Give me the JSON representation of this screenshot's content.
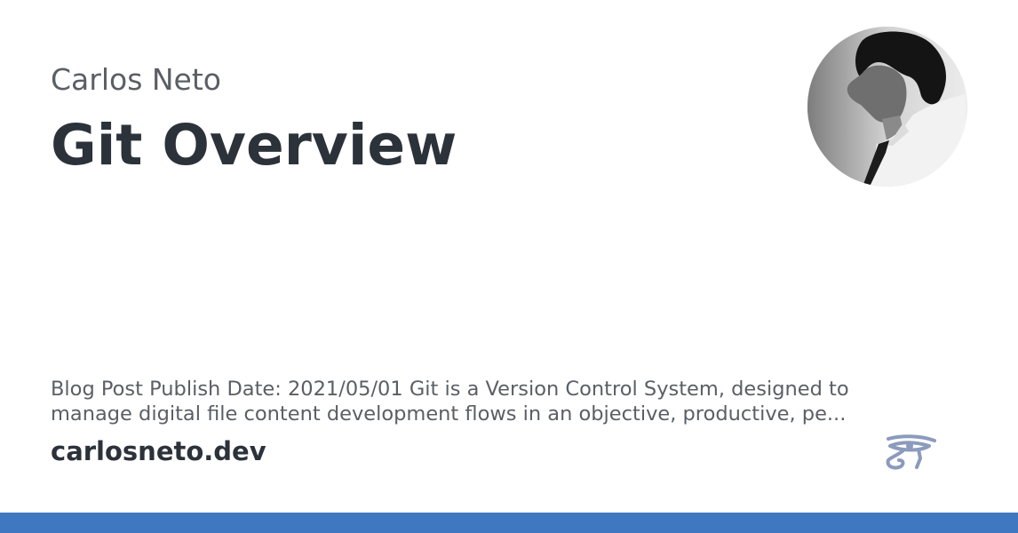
{
  "card": {
    "author": "Carlos Neto",
    "title": "Git Overview",
    "description": "Blog Post Publish Date: 2021/05/01 Git is a Version Control System, designed to manage digital file content development flows in an objective, productive, pe...",
    "domain": "carlosneto.dev",
    "logo_icon": "eye-of-horus-icon",
    "avatar": "author-portrait"
  },
  "colors": {
    "title_text": "#2c323a",
    "secondary_text": "#5b5f65",
    "accent_bar": "#3f78c1",
    "logo": "#8b9bbd"
  }
}
